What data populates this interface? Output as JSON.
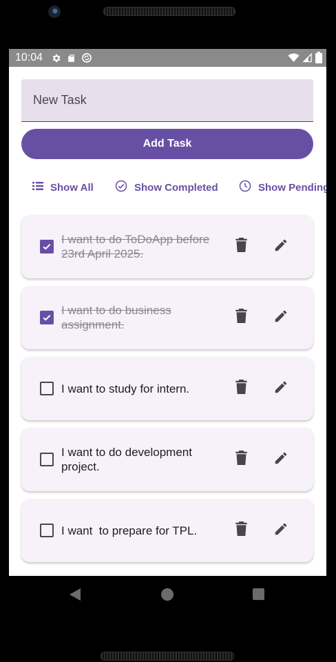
{
  "status_bar": {
    "time": "10:04",
    "left_icons": [
      "gear-icon",
      "sd-card-icon",
      "sync-icon"
    ],
    "right_icons": [
      "wifi-icon",
      "cell-signal-icon",
      "battery-icon"
    ],
    "background": "#8a8a8a"
  },
  "new_task": {
    "placeholder": "New Task",
    "value": ""
  },
  "add_button": {
    "label": "Add Task"
  },
  "filters": [
    {
      "label": "Show All",
      "icon": "list-icon"
    },
    {
      "label": "Show Completed",
      "icon": "check-circle-icon"
    },
    {
      "label": "Show Pending",
      "icon": "clock-icon"
    }
  ],
  "tasks": [
    {
      "text": "I want to do ToDoApp before 23rd April 2025.",
      "completed": true
    },
    {
      "text": "I want to do business assignment.",
      "completed": true
    },
    {
      "text": "I want to study for intern.",
      "completed": false
    },
    {
      "text": "I want to do development project.",
      "completed": false
    },
    {
      "text": "I want  to prepare for TPL.",
      "completed": false
    }
  ],
  "colors": {
    "primary": "#6750a4",
    "input_background": "#e7e0ec",
    "card_background": "#f7f2fa",
    "icon": "#49454f"
  }
}
